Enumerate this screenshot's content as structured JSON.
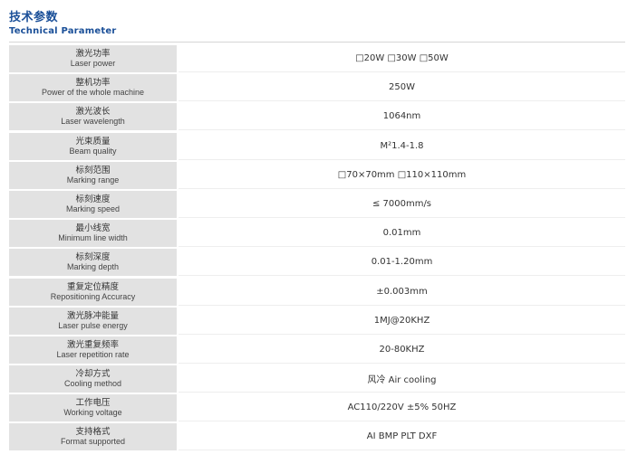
{
  "header": {
    "title_zh": "技术参数",
    "title_en": "Technical Parameter"
  },
  "colors": {
    "accent": "#1a4f98",
    "label_bg": "#e2e2e2"
  },
  "rows": [
    {
      "label_zh": "激光功率",
      "label_en": "Laser power",
      "value": "□20W  □30W  □50W"
    },
    {
      "label_zh": "整机功率",
      "label_en": "Power of the whole machine",
      "value": "250W"
    },
    {
      "label_zh": "激光波长",
      "label_en": "Laser wavelength",
      "value": "1064nm"
    },
    {
      "label_zh": "光束质量",
      "label_en": "Beam quality",
      "value": "M²1.4-1.8"
    },
    {
      "label_zh": "标刻范围",
      "label_en": "Marking  range",
      "value": "□70×70mm  □110×110mm"
    },
    {
      "label_zh": "标刻速度",
      "label_en": "Marking  speed",
      "value": "≤ 7000mm/s"
    },
    {
      "label_zh": "最小线宽",
      "label_en": "Minimum line width",
      "value": "0.01mm"
    },
    {
      "label_zh": "标刻深度",
      "label_en": "Marking depth",
      "value": "0.01-1.20mm"
    },
    {
      "label_zh": "重复定位精度",
      "label_en": "Repositioning Accuracy",
      "value": "±0.003mm"
    },
    {
      "label_zh": "激光脉冲能量",
      "label_en": "Laser pulse energy",
      "value": "1MJ@20KHZ"
    },
    {
      "label_zh": "激光重复频率",
      "label_en": "Laser repetition rate",
      "value": "20-80KHZ"
    },
    {
      "label_zh": "冷却方式",
      "label_en": "Cooling method",
      "value": "风冷   Air cooling"
    },
    {
      "label_zh": "工作电压",
      "label_en": "Working voltage",
      "value": "AC110/220V ±5%  50HZ"
    },
    {
      "label_zh": "支持格式",
      "label_en": "Format supported",
      "value": "AI BMP PLT DXF"
    }
  ]
}
